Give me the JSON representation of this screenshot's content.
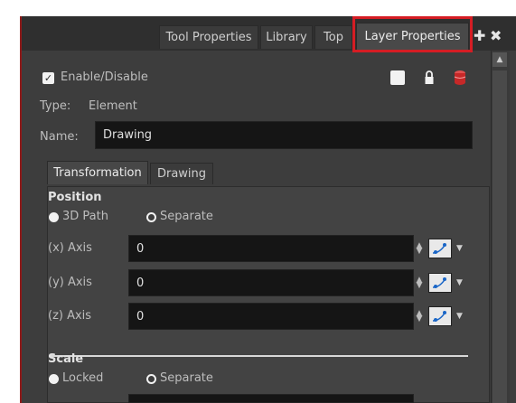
{
  "tabs": [
    {
      "label": "Tool Properties"
    },
    {
      "label": "Library"
    },
    {
      "label": "Top"
    },
    {
      "label": "Layer Properties"
    }
  ],
  "enable": {
    "label": "Enable/Disable",
    "checked": true
  },
  "type": {
    "label": "Type:",
    "value": "Element"
  },
  "name": {
    "label": "Name:",
    "value": "Drawing"
  },
  "subtabs": [
    {
      "label": "Transformation"
    },
    {
      "label": "Drawing"
    }
  ],
  "position": {
    "title": "Position",
    "options": [
      "3D Path",
      "Separate"
    ],
    "axes": [
      {
        "label": "(x) Axis",
        "value": "0"
      },
      {
        "label": "(y) Axis",
        "value": "0"
      },
      {
        "label": "(z) Axis",
        "value": "0"
      }
    ]
  },
  "scale": {
    "title": "Scale",
    "options": [
      "Locked",
      "Separate"
    ]
  },
  "colors": {
    "highlight": "#d51d24",
    "panel": "#3d3d3d",
    "field": "#151515"
  }
}
